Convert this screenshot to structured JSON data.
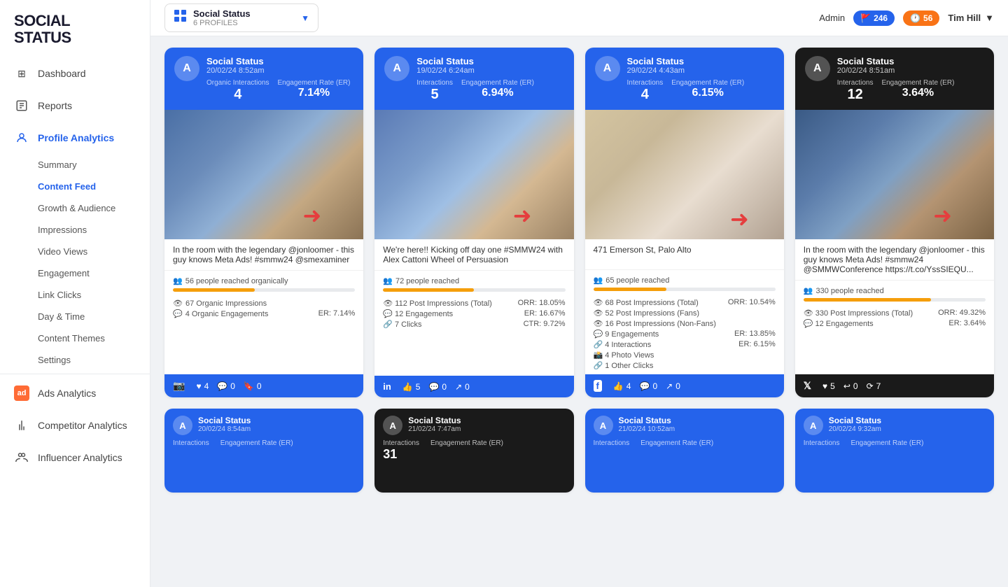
{
  "brand": {
    "name_line1": "SOCIAL",
    "name_line2": "STATUS"
  },
  "topbar": {
    "profile_title": "Social Status",
    "profile_subtitle": "6 PROFILES",
    "admin_label": "Admin",
    "badge1_value": "246",
    "badge2_value": "56",
    "user_name": "Tim Hill"
  },
  "sidebar": {
    "nav": [
      {
        "id": "dashboard",
        "label": "Dashboard",
        "icon": "⊞"
      },
      {
        "id": "reports",
        "label": "Reports",
        "icon": "📄"
      },
      {
        "id": "profile-analytics",
        "label": "Profile Analytics",
        "icon": "👤",
        "active": true
      },
      {
        "id": "ads-analytics",
        "label": "Ads Analytics",
        "icon": "ad"
      },
      {
        "id": "competitor-analytics",
        "label": "Competitor Analytics",
        "icon": "🏆"
      },
      {
        "id": "influencer-analytics",
        "label": "Influencer Analytics",
        "icon": "👥"
      }
    ],
    "sub_items": [
      {
        "id": "summary",
        "label": "Summary"
      },
      {
        "id": "content-feed",
        "label": "Content Feed",
        "active": true
      },
      {
        "id": "growth-audience",
        "label": "Growth & Audience"
      },
      {
        "id": "impressions",
        "label": "Impressions"
      },
      {
        "id": "video-views",
        "label": "Video Views"
      },
      {
        "id": "engagement",
        "label": "Engagement"
      },
      {
        "id": "link-clicks",
        "label": "Link Clicks"
      },
      {
        "id": "day-time",
        "label": "Day & Time"
      },
      {
        "id": "content-themes",
        "label": "Content Themes"
      },
      {
        "id": "settings",
        "label": "Settings"
      }
    ]
  },
  "cards": [
    {
      "id": "card1",
      "platform": "instagram",
      "header_color": "blue",
      "name": "Social Status",
      "date": "20/02/24 8:52am",
      "stat1_label": "Organic Interactions",
      "stat1_value": "4",
      "stat2_label": "Engagement Rate (ER)",
      "stat2_value": "7.14%",
      "caption": "In the room with the legendary @jonloomer - this guy knows Meta Ads! #smmw24 @smexaminer",
      "reach": "56 people reached organically",
      "reach_pct": 45,
      "metrics": [
        {
          "left": "👁 67 Organic Impressions",
          "right": ""
        },
        {
          "left": "💬 4 Organic Engagements",
          "right": "ER: 7.14%"
        }
      ],
      "footer_color": "blue-footer",
      "footer_platform": "📷",
      "footer_stats": [
        {
          "icon": "♥",
          "value": "4"
        },
        {
          "icon": "💬",
          "value": "0"
        },
        {
          "icon": "🔖",
          "value": "0"
        }
      ]
    },
    {
      "id": "card2",
      "platform": "linkedin",
      "header_color": "blue",
      "name": "Social Status",
      "date": "19/02/24 6:24am",
      "stat1_label": "Interactions",
      "stat1_value": "5",
      "stat2_label": "Engagement Rate (ER)",
      "stat2_value": "6.94%",
      "caption": "We're here!! Kicking off day one #SMMW24 with Alex Cattoni Wheel of Persuasion",
      "reach": "72 people reached",
      "reach_pct": 50,
      "metrics": [
        {
          "left": "👁 112 Post Impressions (Total)",
          "right": "ORR: 18.05%"
        },
        {
          "left": "💬 12 Engagements",
          "right": "ER: 16.67%"
        },
        {
          "left": "🔗 7 Clicks",
          "right": "CTR: 9.72%"
        }
      ],
      "footer_color": "blue-footer",
      "footer_platform": "in",
      "footer_stats": [
        {
          "icon": "👍",
          "value": "5"
        },
        {
          "icon": "💬",
          "value": "0"
        },
        {
          "icon": "↗",
          "value": "0"
        }
      ]
    },
    {
      "id": "card3",
      "platform": "facebook",
      "header_color": "blue",
      "name": "Social Status",
      "date": "29/02/24 4:43am",
      "stat1_label": "Interactions",
      "stat1_value": "4",
      "stat2_label": "Engagement Rate (ER)",
      "stat2_value": "6.15%",
      "caption": "471 Emerson St, Palo Alto",
      "reach": "65 people reached",
      "reach_pct": 40,
      "metrics": [
        {
          "left": "👁 68 Post Impressions (Total)",
          "right": "ORR: 10.54%"
        },
        {
          "left": "👁 52 Post Impressions (Fans)",
          "right": ""
        },
        {
          "left": "👁 16 Post Impressions (Non-Fans)",
          "right": ""
        },
        {
          "left": "💬 9 Engagements",
          "right": "ER: 13.85%"
        },
        {
          "left": "🔗 4 Interactions",
          "right": "ER: 6.15%"
        },
        {
          "left": "📸 4 Photo Views",
          "right": ""
        },
        {
          "left": "🔗 1 Other Clicks",
          "right": ""
        }
      ],
      "footer_color": "blue-footer",
      "footer_platform": "f",
      "footer_stats": [
        {
          "icon": "👍",
          "value": "4"
        },
        {
          "icon": "💬",
          "value": "0"
        },
        {
          "icon": "↗",
          "value": "0"
        }
      ]
    },
    {
      "id": "card4",
      "platform": "twitter",
      "header_color": "dark",
      "name": "Social Status",
      "date": "20/02/24 8:51am",
      "stat1_label": "Interactions",
      "stat1_value": "12",
      "stat2_label": "Engagement Rate (ER)",
      "stat2_value": "3.64%",
      "caption": "In the room with the legendary @jonloomer - this guy knows Meta Ads! #smmw24 @SMMWConference https://t.co/YssSIEQU...",
      "reach": "330 people reached",
      "reach_pct": 70,
      "metrics": [
        {
          "left": "👁 330 Post Impressions (Total)",
          "right": "ORR: 49.32%"
        },
        {
          "left": "💬 12 Engagements",
          "right": "ER: 3.64%"
        }
      ],
      "footer_color": "dark-footer",
      "footer_platform": "𝕏",
      "footer_stats": [
        {
          "icon": "♥",
          "value": "5"
        },
        {
          "icon": "↩",
          "value": "0"
        },
        {
          "icon": "⟳",
          "value": "7"
        }
      ]
    }
  ],
  "bottom_cards": [
    {
      "id": "bc1",
      "header_color": "blue",
      "name": "Social Status",
      "date": "20/02/24 8:54am",
      "stat1_label": "Interactions",
      "stat1_value": "",
      "stat2_label": "Engagement Rate (ER)",
      "stat2_value": ""
    },
    {
      "id": "bc2",
      "header_color": "dark",
      "name": "Social Status",
      "date": "21/02/24 7:47am",
      "stat1_label": "Interactions",
      "stat1_value": "31",
      "stat2_label": "Engagement Rate (ER)",
      "stat2_value": ""
    },
    {
      "id": "bc3",
      "header_color": "blue",
      "name": "Social Status",
      "date": "21/02/24 10:52am",
      "stat1_label": "Interactions",
      "stat1_value": "",
      "stat2_label": "Engagement Rate (ER)",
      "stat2_value": ""
    },
    {
      "id": "bc4",
      "header_color": "blue",
      "name": "Social Status",
      "date": "20/02/24 9:32am",
      "stat1_label": "Interactions",
      "stat1_value": "",
      "stat2_label": "Engagement Rate (ER)",
      "stat2_value": ""
    }
  ],
  "colors": {
    "blue": "#2563eb",
    "dark": "#1a1a1a",
    "red_arrow": "#e53e3e",
    "orange": "#f59e0b"
  }
}
